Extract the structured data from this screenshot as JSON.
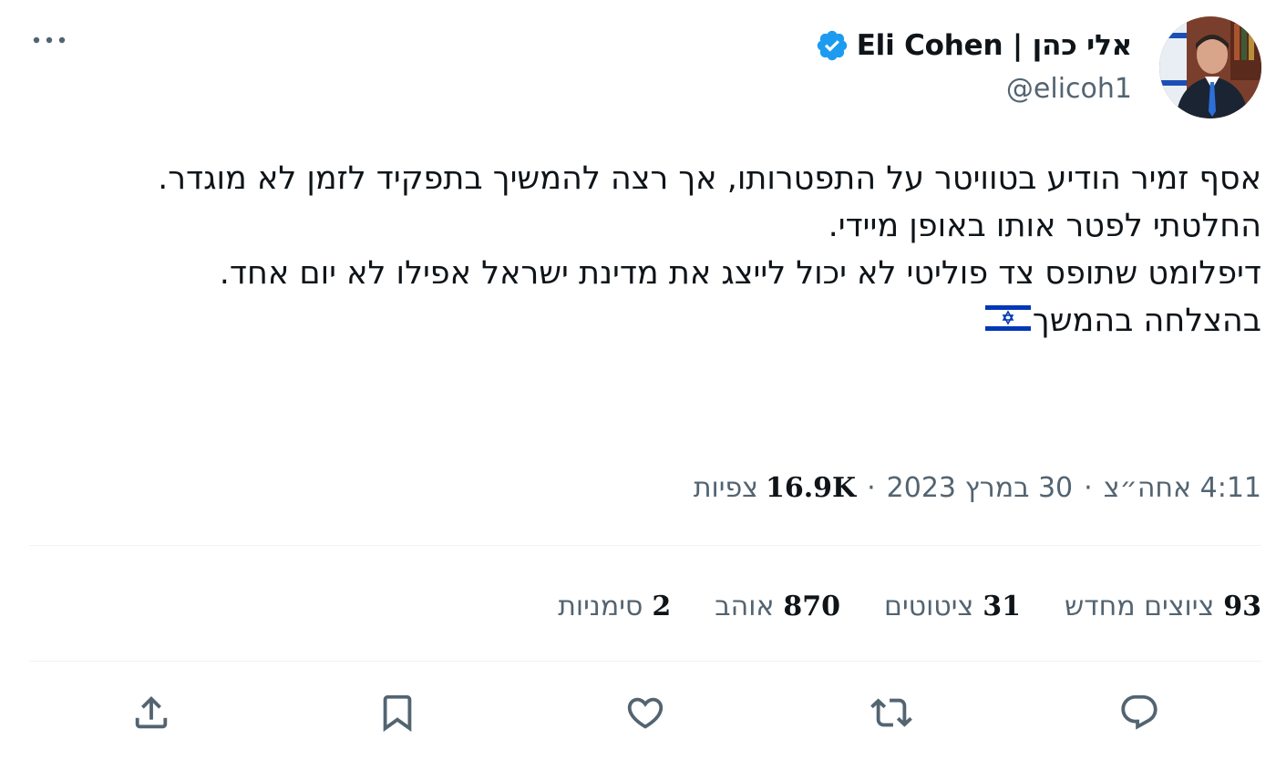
{
  "author": {
    "display_name": "אלי כהן | Eli Cohen",
    "handle": "@elicoh1",
    "verified": true
  },
  "tweet": {
    "lines": [
      "אסף זמיר הודיע בטוויטר על התפטרותו, אך רצה להמשיך בתפקיד לזמן לא מוגדר.",
      "החלטתי לפטר אותו באופן מיידי.",
      "דיפלומט שתופס צד פוליטי לא יכול לייצג את מדינת ישראל אפילו לא יום אחד.",
      "בהצלחה בהמשך"
    ],
    "emoji": "israel-flag"
  },
  "meta": {
    "time": "4:11 אחה״צ",
    "separator": "·",
    "date": "30 במרץ 2023",
    "views_count": "16.9K",
    "views_label": "צפיות"
  },
  "stats": {
    "retweets": {
      "count": "93",
      "label": "ציוצים מחדש"
    },
    "quotes": {
      "count": "31",
      "label": "ציטוטים"
    },
    "likes": {
      "count": "870",
      "label": "אוהב"
    },
    "bookmarks": {
      "count": "2",
      "label": "סימניות"
    }
  },
  "actions": [
    "reply-icon",
    "retweet-icon",
    "like-icon",
    "bookmark-icon",
    "share-icon"
  ],
  "colors": {
    "verified": "#1d9bf0",
    "text": "#0f1419",
    "secondary": "#536471",
    "divider": "#eff3f4",
    "flag_blue": "#0038b8"
  }
}
